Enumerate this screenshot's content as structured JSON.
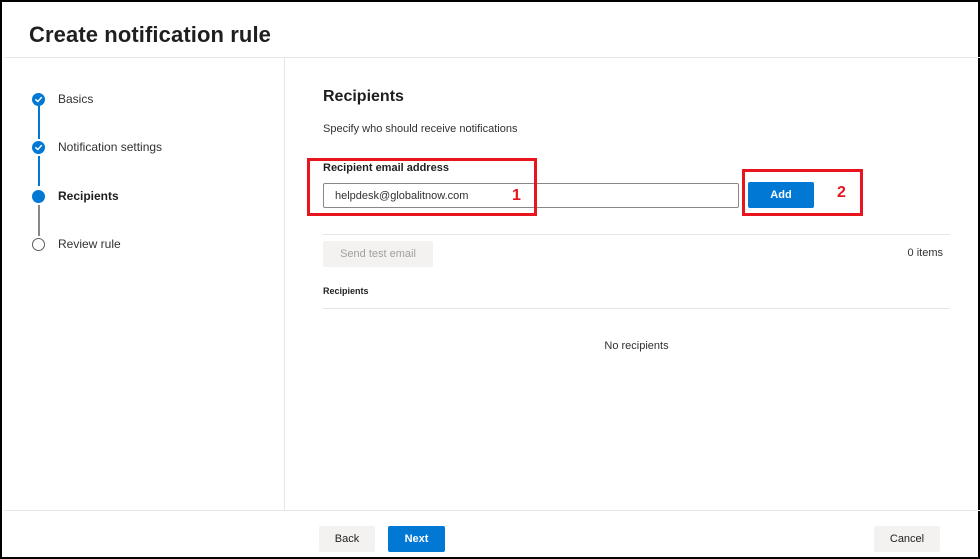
{
  "header": {
    "title": "Create notification rule"
  },
  "wizard": {
    "steps": [
      {
        "label": "Basics",
        "state": "completed"
      },
      {
        "label": "Notification settings",
        "state": "completed"
      },
      {
        "label": "Recipients",
        "state": "current"
      },
      {
        "label": "Review rule",
        "state": "pending"
      }
    ]
  },
  "main": {
    "section_title": "Recipients",
    "section_description": "Specify who should receive notifications",
    "email_field": {
      "label": "Recipient email address",
      "value": "helpdesk@globalitnow.com"
    },
    "add_label": "Add",
    "send_test_label": "Send test email",
    "items_count": "0 items",
    "table_header": "Recipients",
    "empty_text": "No recipients"
  },
  "annotations": {
    "first": "1",
    "second": "2",
    "color": "#e8141e"
  },
  "footer": {
    "back_label": "Back",
    "next_label": "Next",
    "cancel_label": "Cancel"
  },
  "colors": {
    "accent": "#0078d4",
    "annotation": "#e8141e"
  },
  "icons": {
    "completed_step": "check-icon"
  }
}
